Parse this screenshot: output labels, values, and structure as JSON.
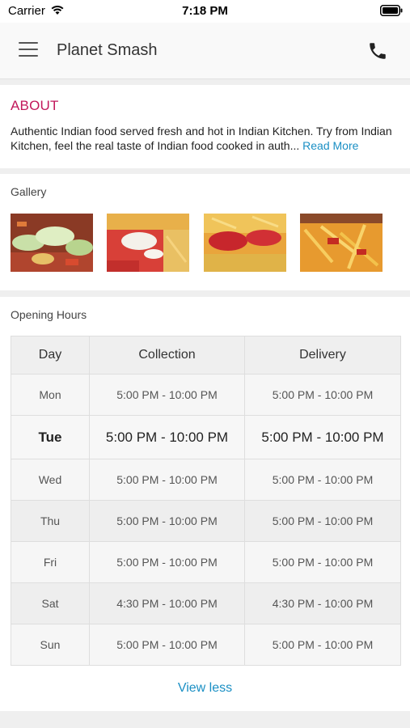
{
  "status_bar": {
    "carrier": "Carrier",
    "time": "7:18 PM"
  },
  "header": {
    "title": "Planet Smash",
    "menu_icon": "hamburger-menu-icon",
    "call_icon": "phone-icon"
  },
  "about": {
    "heading": "ABOUT",
    "text": "Authentic Indian food served fresh and hot in Indian Kitchen. Try from Indian Kitchen, feel the real taste of Indian food cooked in auth...",
    "read_more": "Read More"
  },
  "gallery": {
    "label": "Gallery",
    "image_count": 4
  },
  "opening_hours": {
    "label": "Opening Hours",
    "columns": [
      "Day",
      "Collection",
      "Delivery"
    ],
    "rows": [
      {
        "day": "Mon",
        "collection": "5:00 PM - 10:00 PM",
        "delivery": "5:00 PM - 10:00 PM"
      },
      {
        "day": "Tue",
        "collection": "5:00 PM - 10:00 PM",
        "delivery": "5:00 PM - 10:00 PM"
      },
      {
        "day": "Wed",
        "collection": "5:00 PM - 10:00 PM",
        "delivery": "5:00 PM - 10:00 PM"
      },
      {
        "day": "Thu",
        "collection": "5:00 PM - 10:00 PM",
        "delivery": "5:00 PM - 10:00 PM"
      },
      {
        "day": "Fri",
        "collection": "5:00 PM - 10:00 PM",
        "delivery": "5:00 PM - 10:00 PM"
      },
      {
        "day": "Sat",
        "collection": "4:30 PM - 10:00 PM",
        "delivery": "4:30 PM - 10:00 PM"
      },
      {
        "day": "Sun",
        "collection": "5:00 PM - 10:00 PM",
        "delivery": "5:00 PM - 10:00 PM"
      }
    ],
    "view_less": "View less"
  },
  "colors": {
    "accent": "#c2185b",
    "link": "#1a8fc4"
  }
}
